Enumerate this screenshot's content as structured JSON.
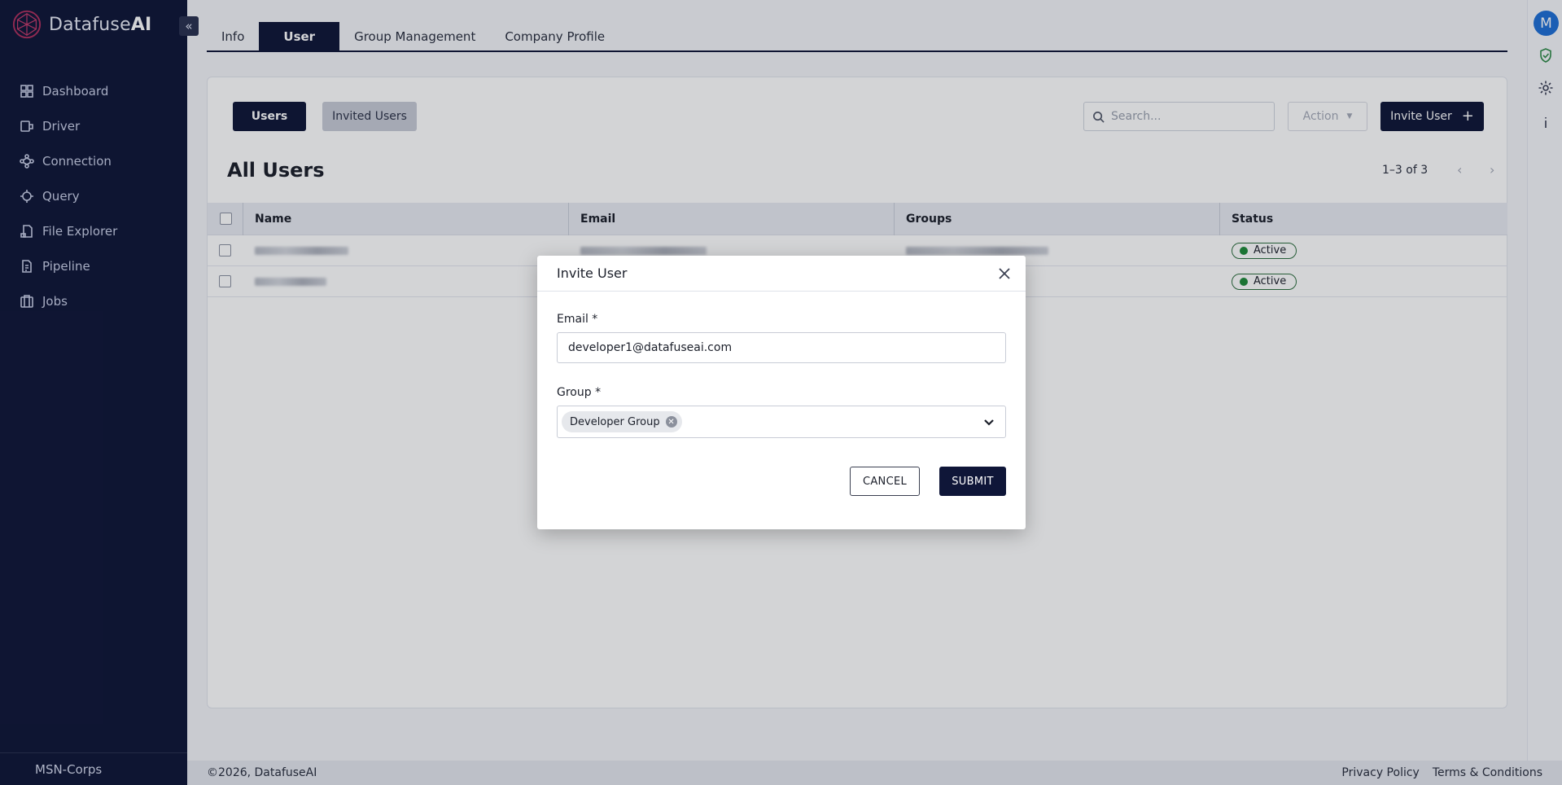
{
  "brand": {
    "name": "Datafuse",
    "name_bold": "AI"
  },
  "sidebar": {
    "collapse_glyph": "«",
    "items": [
      {
        "label": "Dashboard",
        "icon": "dashboard-icon"
      },
      {
        "label": "Driver",
        "icon": "driver-icon"
      },
      {
        "label": "Connection",
        "icon": "connection-icon"
      },
      {
        "label": "Query",
        "icon": "query-icon"
      },
      {
        "label": "File Explorer",
        "icon": "file-explorer-icon"
      },
      {
        "label": "Pipeline",
        "icon": "pipeline-icon"
      },
      {
        "label": "Jobs",
        "icon": "jobs-icon"
      }
    ],
    "org_name": "MSN-Corps"
  },
  "rail": {
    "avatar_letter": "M"
  },
  "tabs": [
    {
      "label": "Info",
      "active": false
    },
    {
      "label": "User",
      "active": true
    },
    {
      "label": "Group Management",
      "active": false
    },
    {
      "label": "Company Profile",
      "active": false
    }
  ],
  "toolbar": {
    "users_label": "Users",
    "invited_label": "Invited Users",
    "search_placeholder": "Search...",
    "action_label": "Action",
    "invite_label": "Invite User",
    "invite_icon": "plus-icon"
  },
  "list": {
    "title": "All Users",
    "pagination": "1–3 of 3",
    "columns": [
      "Name",
      "Email",
      "Groups",
      "Status"
    ],
    "rows": [
      {
        "status": "Active"
      },
      {
        "status": "Active"
      }
    ]
  },
  "footer": {
    "copyright": "©2026, DatafuseAI",
    "privacy": "Privacy Policy",
    "terms": "Terms & Conditions"
  },
  "modal": {
    "title": "Invite User",
    "email_label": "Email *",
    "email_value": "developer1@datafuseai.com",
    "group_label": "Group *",
    "group_chip": "Developer Group",
    "cancel_label": "CANCEL",
    "submit_label": "SUBMIT"
  },
  "colors": {
    "navy": "#0f1638",
    "status_green": "#1f8a3a",
    "avatar_blue": "#1f6fd6"
  }
}
